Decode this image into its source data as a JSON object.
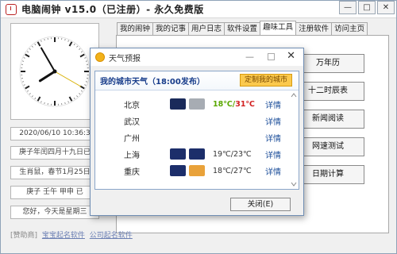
{
  "app": {
    "title": "电脑闹钟 v15.0（已注册）- 永久免费版",
    "controls": {
      "minimize": "—",
      "maximize": "□",
      "close": "✕"
    }
  },
  "left": {
    "clock": {
      "hours": 7,
      "minutes": 55,
      "seconds": 20
    },
    "datetime": "2020/06/10  10:36:3",
    "lunar": "庚子年闰四月十九日已",
    "zodiac": "生肖鼠，春节1月25日",
    "ganzhi": "庚子  壬午  甲申  已",
    "greeting": "您好，今天是星期三"
  },
  "tabs": [
    "我的闹钟",
    "我的记事",
    "用户日志",
    "软件设置",
    "趣味工具",
    "注册软件",
    "访问主页"
  ],
  "active_tab": "趣味工具",
  "tools": [
    "万年历",
    "十二时辰表",
    "新闻阅读",
    "网速测试",
    "日期计算"
  ],
  "sponsor": {
    "label": "[赞助商]",
    "link1": "宝宝起名软件",
    "link2": "公司起名软件"
  },
  "weather": {
    "window_title": "天气预报",
    "heading": "我的城市天气（18:00发布）",
    "custom_button": "定制我的城市",
    "ok_button": "关闭(E)",
    "detail_label": "详情",
    "rows": [
      {
        "city": "北京",
        "temp": "18℃/31℃",
        "icon1": "cloudy-night-icon",
        "icon2": "overcast-icon",
        "highlight": true
      },
      {
        "city": "武汉",
        "temp": "",
        "icon1": "",
        "icon2": "",
        "highlight": false
      },
      {
        "city": "广州",
        "temp": "",
        "icon1": "",
        "icon2": "",
        "highlight": false
      },
      {
        "city": "上海",
        "temp": "19℃/23℃",
        "icon1": "rain-icon",
        "icon2": "rain-icon",
        "highlight": false
      },
      {
        "city": "重庆",
        "temp": "18℃/27℃",
        "icon1": "rain-icon",
        "icon2": "partly-sunny-icon",
        "highlight": false
      }
    ]
  },
  "colors": {
    "accent_blue": "#173c8a",
    "temp_green": "#5aa800",
    "temp_red": "#d22020",
    "custom_btn": "#fbc94d"
  }
}
